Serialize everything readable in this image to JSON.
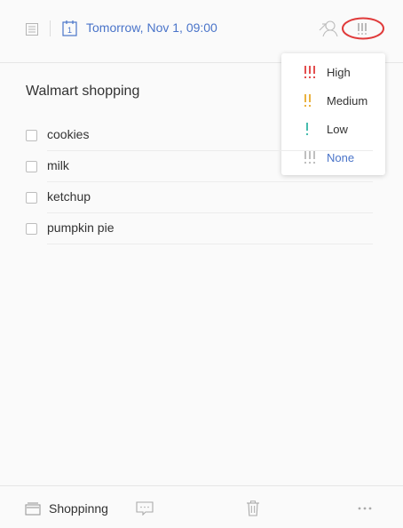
{
  "header": {
    "date_label": "Tomorrow,  Nov 1, 09:00",
    "list_icon": "list-icon",
    "calendar_icon": "calendar-icon",
    "assign_icon": "assign-user-icon",
    "priority_icon": "priority-icon",
    "accent_color": "#4a74c9"
  },
  "priority_menu": {
    "items": [
      {
        "label": "High",
        "marks": "!!!",
        "color": "#e03a3a"
      },
      {
        "label": "Medium",
        "marks": "!!",
        "color": "#e8a92b"
      },
      {
        "label": "Low",
        "marks": "!",
        "color": "#33b5a5"
      },
      {
        "label": "None",
        "marks": "!!!",
        "color": "#b8b8b8"
      }
    ],
    "highlight_color": "#e03a3a"
  },
  "task": {
    "title": "Walmart shopping",
    "checklist": [
      {
        "text": "cookies",
        "checked": false
      },
      {
        "text": "milk",
        "checked": false
      },
      {
        "text": "ketchup",
        "checked": false
      },
      {
        "text": "pumpkin pie",
        "checked": false
      }
    ]
  },
  "footer": {
    "list_name": "Shoppinng",
    "list_icon": "inbox-icon",
    "comment_icon": "comment-icon",
    "trash_icon": "trash-icon",
    "more_icon": "more-icon"
  }
}
